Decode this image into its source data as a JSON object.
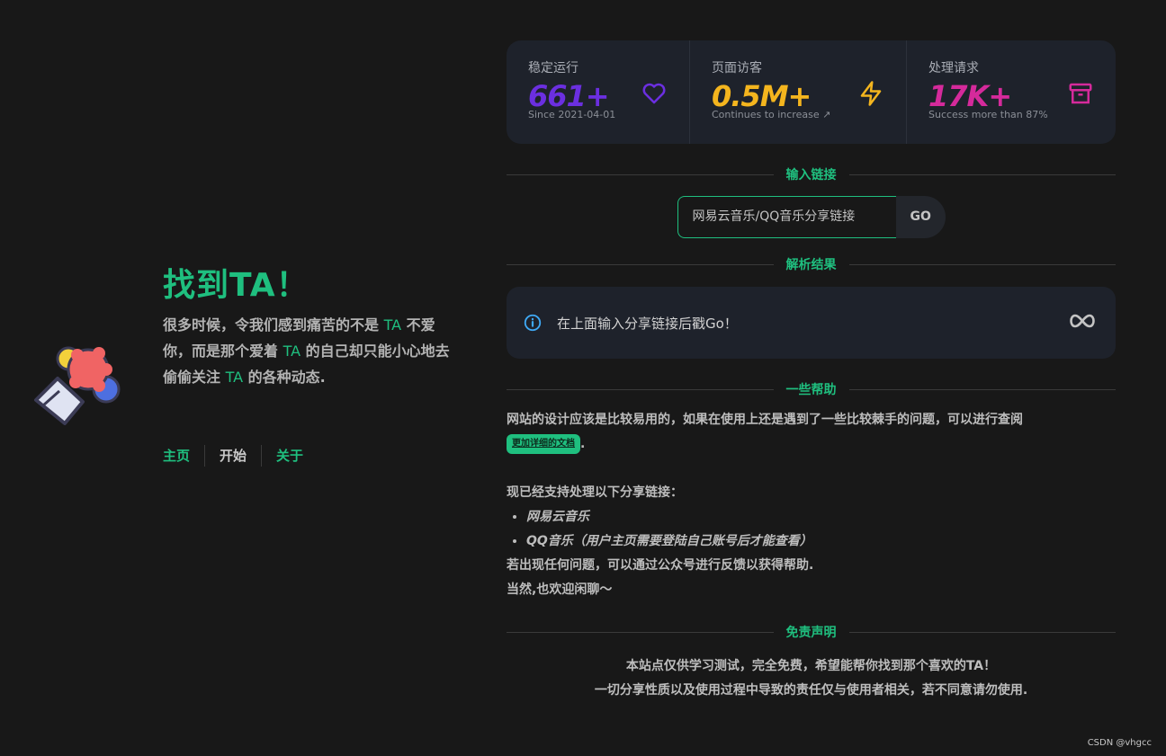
{
  "hero": {
    "title": "找到TA！",
    "desc_1": "很多时候，令我们感到痛苦的不是 ",
    "desc_ta1": "TA",
    "desc_2": " 不爱你，而是那个爱着 ",
    "desc_ta2": "TA",
    "desc_3": " 的自己却只能小心地去偷偷关注 ",
    "desc_ta3": "TA",
    "desc_4": " 的各种动态."
  },
  "nav": {
    "home": "主页",
    "start": "开始",
    "about": "关于"
  },
  "stats": [
    {
      "label": "稳定运行",
      "value": "661+",
      "sub": "Since 2021-04-01",
      "color": "#6b2fe0",
      "icon": "heart-icon"
    },
    {
      "label": "页面访客",
      "value": "0.5M+",
      "sub": "Continues to increase ↗",
      "color": "#f4b51e",
      "icon": "lightning-icon"
    },
    {
      "label": "处理请求",
      "value": "17K+",
      "sub": "Success more than 87%",
      "color": "#d52a9b",
      "icon": "archive-icon"
    }
  ],
  "sections": {
    "input": "输入链接",
    "result": "解析结果",
    "help": "一些帮助",
    "disclaimer": "免责声明"
  },
  "search": {
    "placeholder": "网易云音乐/QQ音乐分享链接",
    "go": "GO"
  },
  "result": {
    "message": "在上面输入分享链接后戳Go！"
  },
  "help": {
    "line1": "网站的设计应该是比较易用的，如果在使用上还是遇到了一些比较棘手的问题，可以进行查阅",
    "doc_label": "更加详细的文档",
    "dot": ".",
    "supported": "现已经支持处理以下分享链接：",
    "item1": "网易云音乐",
    "item2": "QQ音乐（用户主页需要登陆自己账号后才能查看）",
    "line2": "若出现任何问题，可以通过公众号进行反馈以获得帮助.",
    "line3": "当然,也欢迎闲聊～"
  },
  "disclaimer": {
    "line1": "本站点仅供学习测试，完全免费，希望能帮你找到那个喜欢的TA！",
    "line2": "一切分享性质以及使用过程中导致的责任仅与使用者相关，若不同意请勿使用."
  },
  "watermark": "CSDN @vhgcc",
  "colors": {
    "accent": "#1fbf7f",
    "bg": "#181818",
    "card": "#1e222b"
  }
}
